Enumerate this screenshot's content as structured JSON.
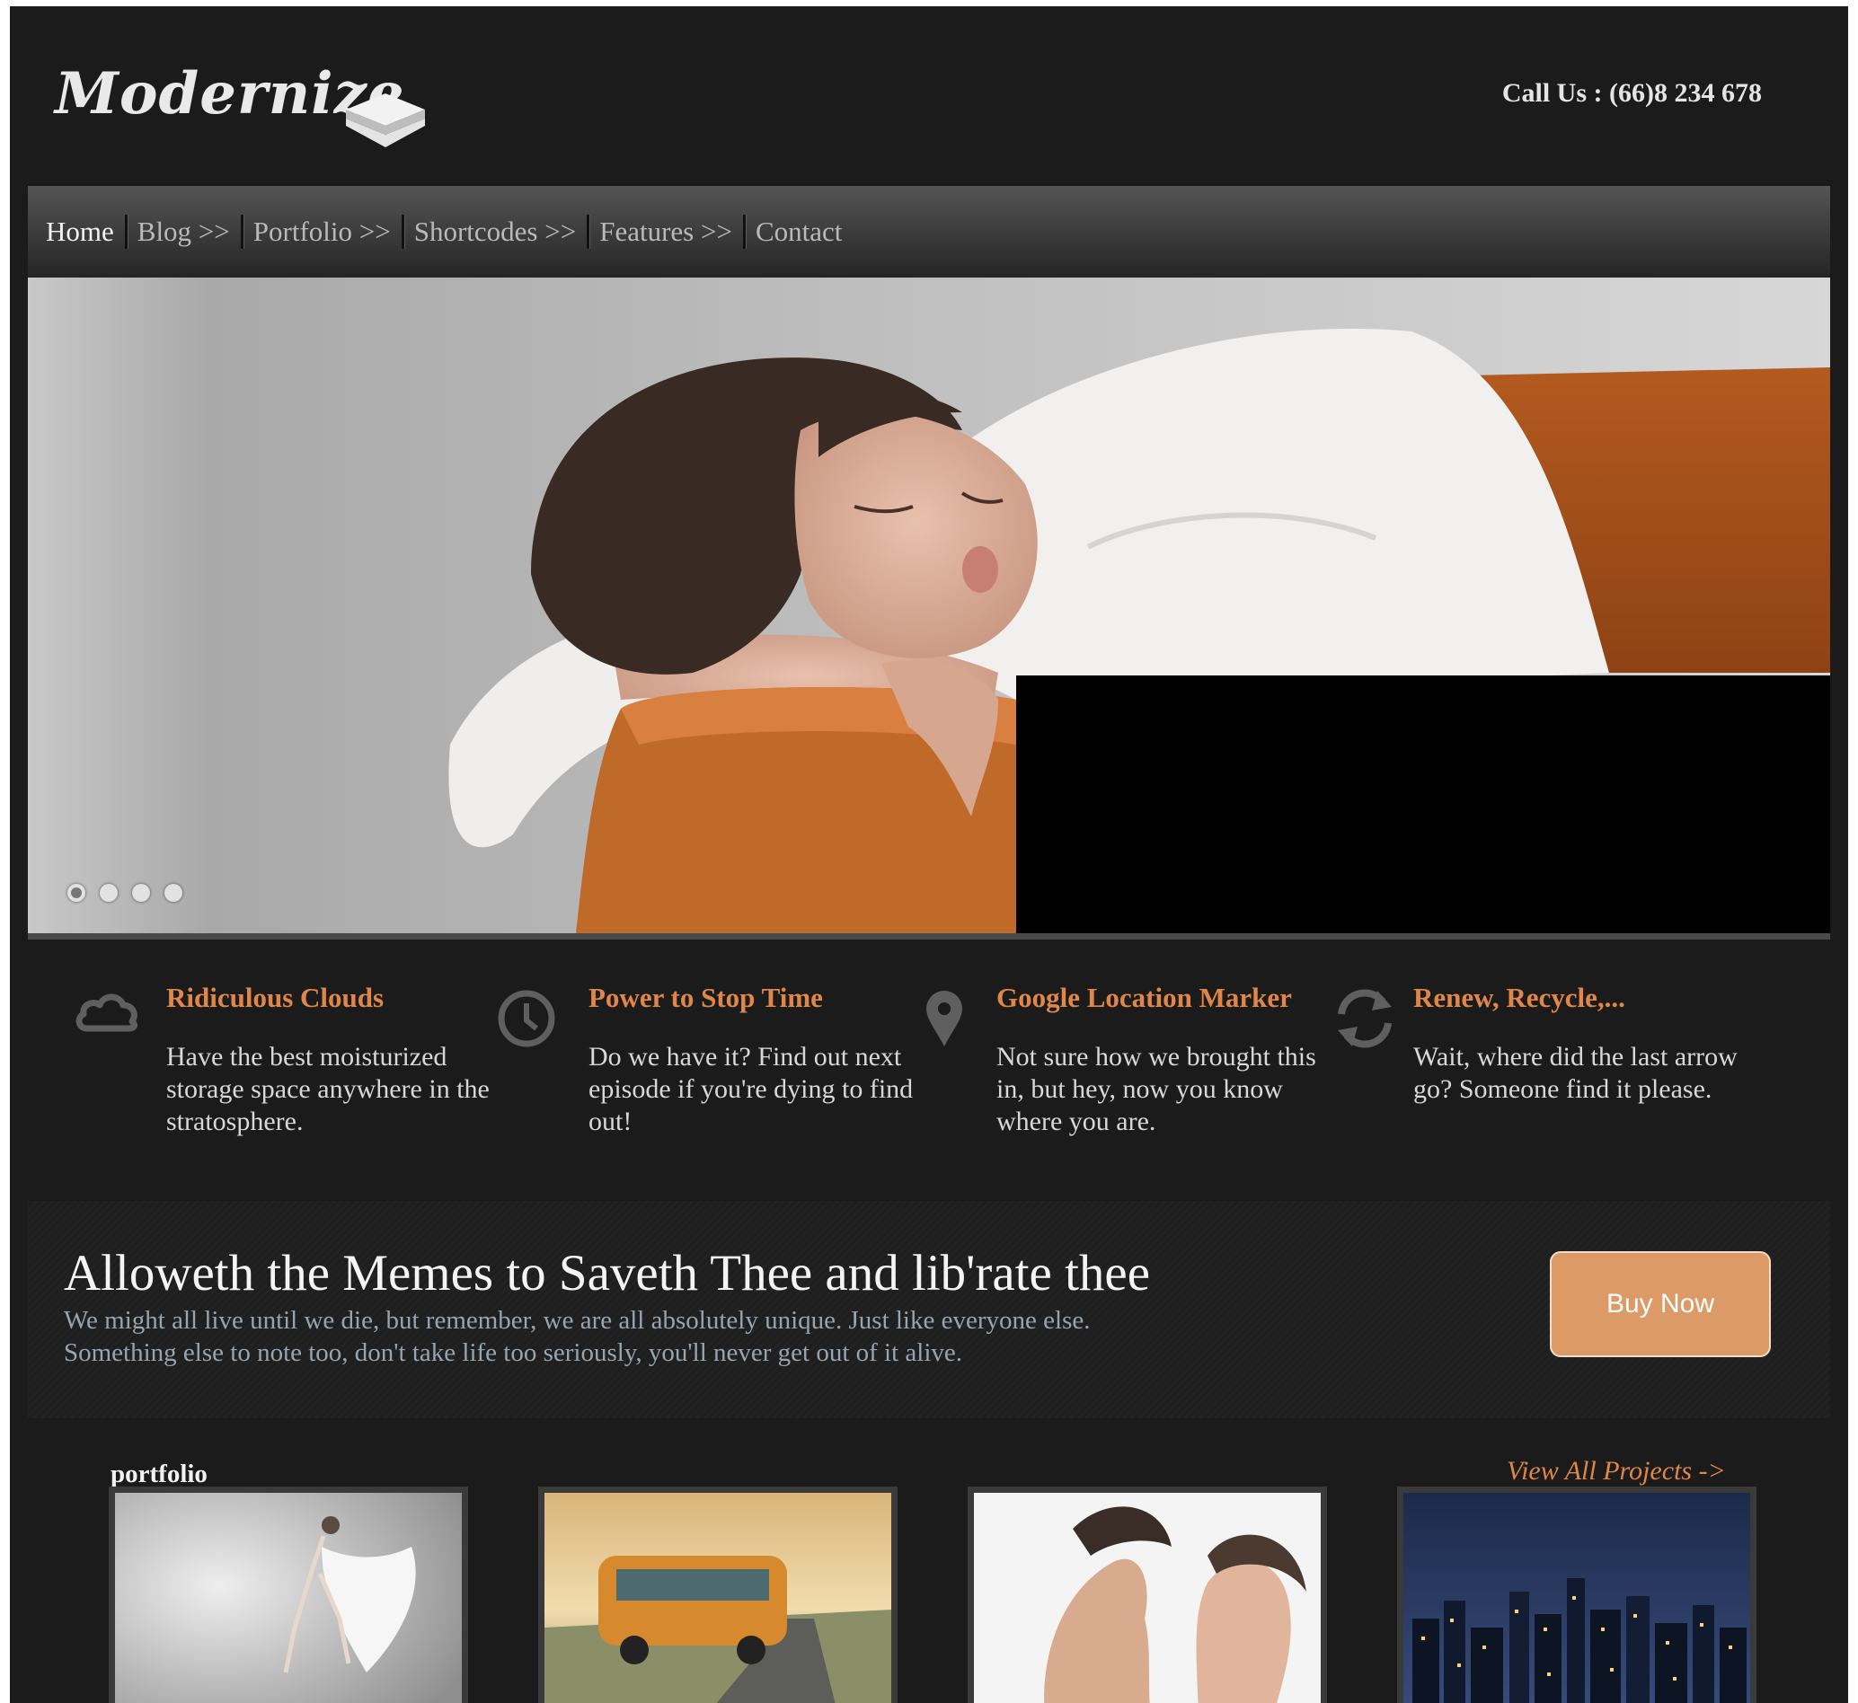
{
  "header": {
    "logo_text": "Modernize",
    "call_us": "Call Us : (66)8 234 678"
  },
  "nav": {
    "items": [
      {
        "label": "Home"
      },
      {
        "label": "Blog >>"
      },
      {
        "label": "Portfolio >>"
      },
      {
        "label": "Shortcodes >>"
      },
      {
        "label": "Features >>"
      },
      {
        "label": "Contact"
      }
    ]
  },
  "slider": {
    "slide_count": 4,
    "active_slide": 1
  },
  "features": [
    {
      "icon": "cloud-icon",
      "title": "Ridiculous Clouds",
      "text": "Have the best moisturized storage space anywhere in the stratosphere."
    },
    {
      "icon": "clock-icon",
      "title": "Power to Stop Time",
      "text": "Do we have it? Find out next episode if you're dying to find out!"
    },
    {
      "icon": "location-marker-icon",
      "title": "Google Location Marker",
      "text": "Not sure how we brought this in, but hey, now you know where you are."
    },
    {
      "icon": "recycle-icon",
      "title": "Renew, Recycle,...",
      "text": "Wait, where did the last arrow go? Someone find it please."
    }
  ],
  "promo": {
    "heading": "Alloweth the Memes to Saveth Thee and lib'rate thee",
    "line1": "We might all live until we die, but remember, we are all absolutely unique. Just like everyone else.",
    "line2": "Something else to note too, don't take life too seriously, you'll never get out of it alive.",
    "button": "Buy Now"
  },
  "portfolio": {
    "title": "portfolio",
    "view_all": "View All Projects ->"
  },
  "colors": {
    "background": "#1b1b1b",
    "accent": "#e0864a",
    "button": "#dc9a66"
  }
}
